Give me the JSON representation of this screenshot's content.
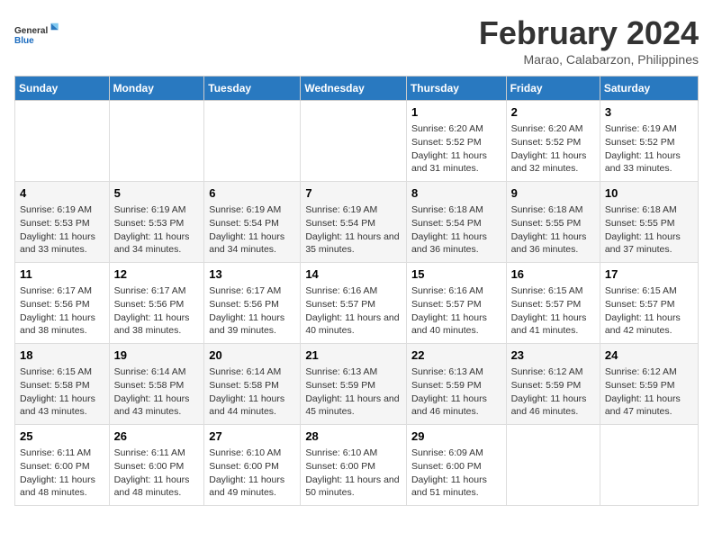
{
  "logo": {
    "line1": "General",
    "line2": "Blue"
  },
  "title": "February 2024",
  "subtitle": "Marao, Calabarzon, Philippines",
  "headers": [
    "Sunday",
    "Monday",
    "Tuesday",
    "Wednesday",
    "Thursday",
    "Friday",
    "Saturday"
  ],
  "weeks": [
    [
      {
        "day": "",
        "info": ""
      },
      {
        "day": "",
        "info": ""
      },
      {
        "day": "",
        "info": ""
      },
      {
        "day": "",
        "info": ""
      },
      {
        "day": "1",
        "info": "Sunrise: 6:20 AM\nSunset: 5:52 PM\nDaylight: 11 hours and 31 minutes."
      },
      {
        "day": "2",
        "info": "Sunrise: 6:20 AM\nSunset: 5:52 PM\nDaylight: 11 hours and 32 minutes."
      },
      {
        "day": "3",
        "info": "Sunrise: 6:19 AM\nSunset: 5:52 PM\nDaylight: 11 hours and 33 minutes."
      }
    ],
    [
      {
        "day": "4",
        "info": "Sunrise: 6:19 AM\nSunset: 5:53 PM\nDaylight: 11 hours and 33 minutes."
      },
      {
        "day": "5",
        "info": "Sunrise: 6:19 AM\nSunset: 5:53 PM\nDaylight: 11 hours and 34 minutes."
      },
      {
        "day": "6",
        "info": "Sunrise: 6:19 AM\nSunset: 5:54 PM\nDaylight: 11 hours and 34 minutes."
      },
      {
        "day": "7",
        "info": "Sunrise: 6:19 AM\nSunset: 5:54 PM\nDaylight: 11 hours and 35 minutes."
      },
      {
        "day": "8",
        "info": "Sunrise: 6:18 AM\nSunset: 5:54 PM\nDaylight: 11 hours and 36 minutes."
      },
      {
        "day": "9",
        "info": "Sunrise: 6:18 AM\nSunset: 5:55 PM\nDaylight: 11 hours and 36 minutes."
      },
      {
        "day": "10",
        "info": "Sunrise: 6:18 AM\nSunset: 5:55 PM\nDaylight: 11 hours and 37 minutes."
      }
    ],
    [
      {
        "day": "11",
        "info": "Sunrise: 6:17 AM\nSunset: 5:56 PM\nDaylight: 11 hours and 38 minutes."
      },
      {
        "day": "12",
        "info": "Sunrise: 6:17 AM\nSunset: 5:56 PM\nDaylight: 11 hours and 38 minutes."
      },
      {
        "day": "13",
        "info": "Sunrise: 6:17 AM\nSunset: 5:56 PM\nDaylight: 11 hours and 39 minutes."
      },
      {
        "day": "14",
        "info": "Sunrise: 6:16 AM\nSunset: 5:57 PM\nDaylight: 11 hours and 40 minutes."
      },
      {
        "day": "15",
        "info": "Sunrise: 6:16 AM\nSunset: 5:57 PM\nDaylight: 11 hours and 40 minutes."
      },
      {
        "day": "16",
        "info": "Sunrise: 6:15 AM\nSunset: 5:57 PM\nDaylight: 11 hours and 41 minutes."
      },
      {
        "day": "17",
        "info": "Sunrise: 6:15 AM\nSunset: 5:57 PM\nDaylight: 11 hours and 42 minutes."
      }
    ],
    [
      {
        "day": "18",
        "info": "Sunrise: 6:15 AM\nSunset: 5:58 PM\nDaylight: 11 hours and 43 minutes."
      },
      {
        "day": "19",
        "info": "Sunrise: 6:14 AM\nSunset: 5:58 PM\nDaylight: 11 hours and 43 minutes."
      },
      {
        "day": "20",
        "info": "Sunrise: 6:14 AM\nSunset: 5:58 PM\nDaylight: 11 hours and 44 minutes."
      },
      {
        "day": "21",
        "info": "Sunrise: 6:13 AM\nSunset: 5:59 PM\nDaylight: 11 hours and 45 minutes."
      },
      {
        "day": "22",
        "info": "Sunrise: 6:13 AM\nSunset: 5:59 PM\nDaylight: 11 hours and 46 minutes."
      },
      {
        "day": "23",
        "info": "Sunrise: 6:12 AM\nSunset: 5:59 PM\nDaylight: 11 hours and 46 minutes."
      },
      {
        "day": "24",
        "info": "Sunrise: 6:12 AM\nSunset: 5:59 PM\nDaylight: 11 hours and 47 minutes."
      }
    ],
    [
      {
        "day": "25",
        "info": "Sunrise: 6:11 AM\nSunset: 6:00 PM\nDaylight: 11 hours and 48 minutes."
      },
      {
        "day": "26",
        "info": "Sunrise: 6:11 AM\nSunset: 6:00 PM\nDaylight: 11 hours and 48 minutes."
      },
      {
        "day": "27",
        "info": "Sunrise: 6:10 AM\nSunset: 6:00 PM\nDaylight: 11 hours and 49 minutes."
      },
      {
        "day": "28",
        "info": "Sunrise: 6:10 AM\nSunset: 6:00 PM\nDaylight: 11 hours and 50 minutes."
      },
      {
        "day": "29",
        "info": "Sunrise: 6:09 AM\nSunset: 6:00 PM\nDaylight: 11 hours and 51 minutes."
      },
      {
        "day": "",
        "info": ""
      },
      {
        "day": "",
        "info": ""
      }
    ]
  ]
}
